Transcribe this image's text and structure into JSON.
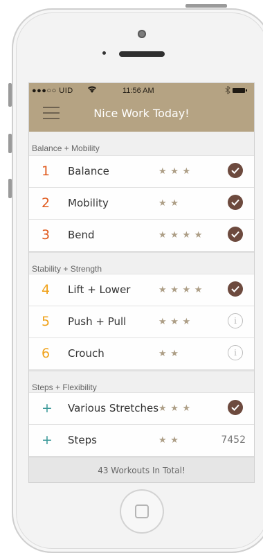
{
  "status_bar": {
    "carrier": "●●●○○ UID",
    "wifi_icon": "wifi-icon",
    "time": "11:56 AM",
    "bluetooth_icon": "bluetooth-icon",
    "battery_icon": "battery-icon"
  },
  "header": {
    "title": "Nice Work Today!",
    "menu_icon": "hamburger-menu-icon",
    "background_color": "#b5a383"
  },
  "sections": [
    {
      "title": "Balance + Mobility",
      "accent_color": "#e05a1e",
      "items": [
        {
          "number": "1",
          "name": "Balance",
          "stars": "★ ★ ★",
          "status": "done"
        },
        {
          "number": "2",
          "name": "Mobility",
          "stars": "★ ★",
          "status": "done"
        },
        {
          "number": "3",
          "name": "Bend",
          "stars": "★ ★ ★ ★",
          "status": "done"
        }
      ]
    },
    {
      "title": "Stability + Strength",
      "accent_color": "#f0a21a",
      "items": [
        {
          "number": "4",
          "name": "Lift + Lower",
          "stars": "★ ★ ★ ★",
          "status": "done"
        },
        {
          "number": "5",
          "name": "Push + Pull",
          "stars": "★ ★ ★",
          "status": "info"
        },
        {
          "number": "6",
          "name": "Crouch",
          "stars": "★ ★",
          "status": "info"
        }
      ]
    },
    {
      "title": "Steps + Flexibility",
      "accent_color": "#3d9a9a",
      "items": [
        {
          "number": "+",
          "name": "Various Stretches",
          "stars": "★ ★ ★",
          "status": "done"
        },
        {
          "number": "+",
          "name": "Steps",
          "stars": "★ ★",
          "status": "count",
          "count": "7452"
        }
      ]
    }
  ],
  "footer": {
    "total_text": "43 Workouts In Total!"
  },
  "colors": {
    "check": "#6d4a3e",
    "star": "#ad9e86"
  },
  "icons": {
    "done": "checkmark-icon",
    "info": "info-icon",
    "star": "star-icon"
  }
}
